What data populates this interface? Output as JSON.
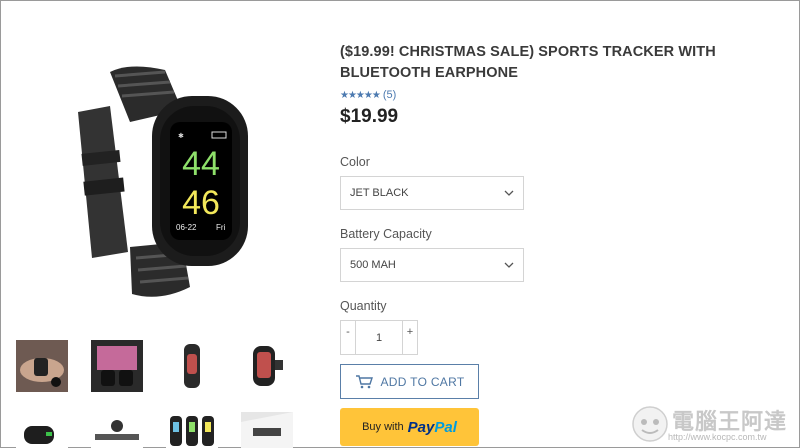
{
  "product": {
    "title": "($19.99! CHRISTMAS SALE) SPORTS TRACKER WITH BLUETOOTH EARPHONE",
    "stars": "★★★★★",
    "rating_count": "(5)",
    "price": "$19.99"
  },
  "watch_screen": {
    "top_number": "44",
    "bottom_number": "46",
    "date": "06-22",
    "day": "Fri"
  },
  "options": {
    "color_label": "Color",
    "color_value": "JET BLACK",
    "battery_label": "Battery Capacity",
    "battery_value": "500 MAH"
  },
  "quantity": {
    "label": "Quantity",
    "minus": "-",
    "plus": "+",
    "value": "1"
  },
  "buttons": {
    "add_to_cart": "ADD TO CART",
    "paypal_prefix": "Buy with",
    "paypal_pay": "Pay",
    "paypal_pal": "Pal"
  },
  "watermark": {
    "text": "電腦王阿達",
    "url": "http://www.kocpc.com.tw"
  },
  "colors": {
    "accent": "#4f77a3",
    "paypal_yellow": "#ffc439",
    "watch_green": "#8ee06a",
    "watch_yellow": "#f3e85a"
  }
}
